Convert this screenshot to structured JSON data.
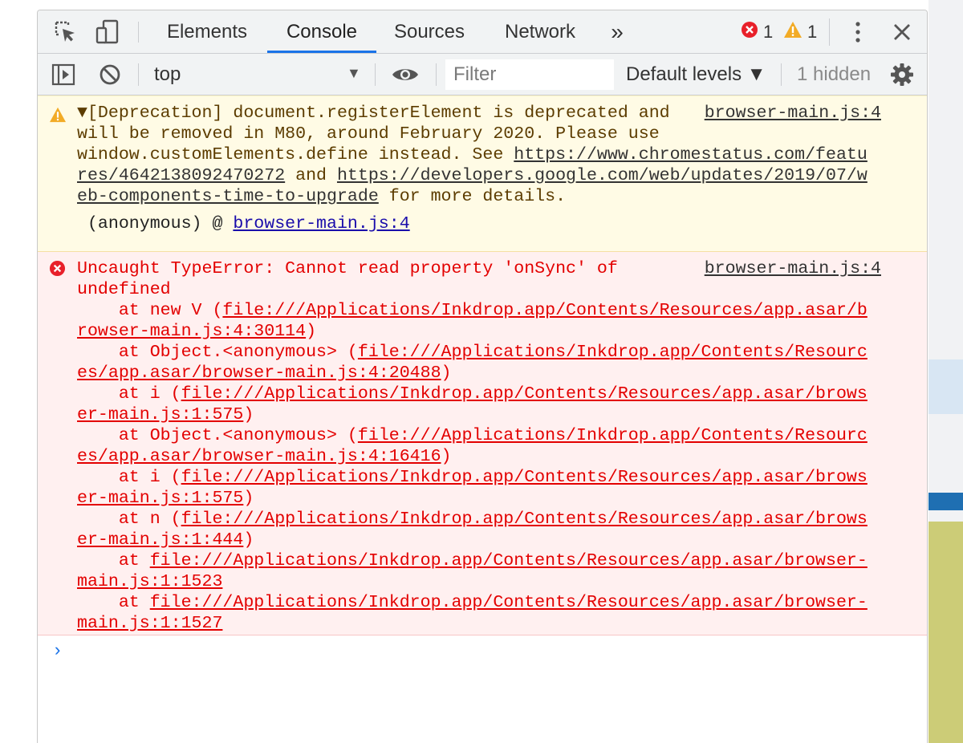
{
  "tabs": {
    "elements": "Elements",
    "console": "Console",
    "sources": "Sources",
    "network": "Network",
    "more": "»"
  },
  "counters": {
    "errors": "1",
    "warnings": "1"
  },
  "toolbar": {
    "context": "top",
    "filter_placeholder": "Filter",
    "levels": "Default levels ▼",
    "hidden": "1 hidden"
  },
  "warning": {
    "source": "browser-main.js:4",
    "l1": "▼[Deprecation] document.registerElement is deprecated and",
    "l2": "will be removed in M80, around February 2020. Please use",
    "l3a": "window.customElements.define instead. See ",
    "l3b": "https://www.chromestatus.com/featu",
    "l4a": "res/4642138092470272",
    "l4b": " and ",
    "l4c": "https://developers.google.com/web/updates/2019/07/w",
    "l5a": "eb-components-time-to-upgrade",
    "l5b": " for more details.",
    "stack_prefix": " (anonymous) @ ",
    "stack_link": "browser-main.js:4"
  },
  "error": {
    "source": "browser-main.js:4",
    "l1": "Uncaught TypeError: Cannot read property 'onSync' of",
    "l2": "undefined",
    "frames": [
      {
        "pre": "    at new V (",
        "link1": "file:///Applications/Inkdrop.app/Contents/Resources/app.asar/b",
        "link2": "rowser-main.js:4:30114",
        "post": ")"
      },
      {
        "pre": "    at Object.<anonymous> (",
        "link1": "file:///Applications/Inkdrop.app/Contents/Resourc",
        "link2": "es/app.asar/browser-main.js:4:20488",
        "post": ")"
      },
      {
        "pre": "    at i (",
        "link1": "file:///Applications/Inkdrop.app/Contents/Resources/app.asar/brows",
        "link2": "er-main.js:1:575",
        "post": ")"
      },
      {
        "pre": "    at Object.<anonymous> (",
        "link1": "file:///Applications/Inkdrop.app/Contents/Resourc",
        "link2": "es/app.asar/browser-main.js:4:16416",
        "post": ")"
      },
      {
        "pre": "    at i (",
        "link1": "file:///Applications/Inkdrop.app/Contents/Resources/app.asar/brows",
        "link2": "er-main.js:1:575",
        "post": ")"
      },
      {
        "pre": "    at n (",
        "link1": "file:///Applications/Inkdrop.app/Contents/Resources/app.asar/brows",
        "link2": "er-main.js:1:444",
        "post": ")"
      },
      {
        "pre": "    at ",
        "link1": "file:///Applications/Inkdrop.app/Contents/Resources/app.asar/browser-",
        "link2": "main.js:1:1523",
        "post": ""
      },
      {
        "pre": "    at ",
        "link1": "file:///Applications/Inkdrop.app/Contents/Resources/app.asar/browser-",
        "link2": "main.js:1:1527",
        "post": ""
      }
    ]
  },
  "prompt": "›",
  "colors": {
    "accent": "#1a73e8",
    "error_red": "#e30000",
    "warning_yellow": "#f2ab26",
    "warning_bg": "#fffbe5",
    "error_bg": "#fff0f0"
  },
  "icons": [
    "inspect-element-icon",
    "device-toolbar-icon",
    "error-count-icon",
    "warning-count-icon",
    "kebab-menu-icon",
    "close-icon",
    "sidebar-toggle-icon",
    "clear-console-icon",
    "dropdown-arrow-icon",
    "live-expression-eye-icon",
    "settings-gear-icon",
    "warning-icon",
    "error-icon",
    "prompt-chevron-icon"
  ]
}
